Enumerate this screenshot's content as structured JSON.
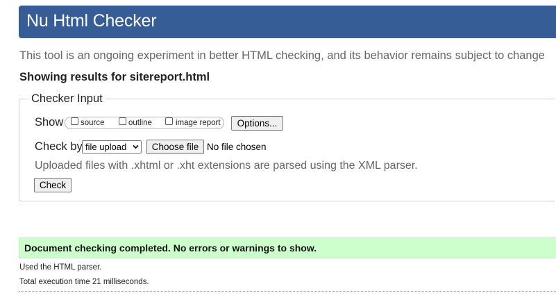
{
  "header": {
    "title": "Nu Html Checker"
  },
  "tagline": "This tool is an ongoing experiment in better HTML checking, and its behavior remains subject to change",
  "results_heading": "Showing results for sitereport.html",
  "checker_input": {
    "legend": "Checker Input",
    "show": {
      "label": "Show",
      "options": [
        {
          "label": "source",
          "checked": false
        },
        {
          "label": "outline",
          "checked": false
        },
        {
          "label": "image report",
          "checked": false
        }
      ],
      "options_button": "Options..."
    },
    "check_by": {
      "label": "Check by",
      "selected": "file upload",
      "choose_file_button": "Choose file",
      "file_status": "No file chosen"
    },
    "hint": "Uploaded files with .xhtml or .xht extensions are parsed using the XML parser.",
    "check_button": "Check"
  },
  "result": {
    "message": "Document checking completed. No errors or warnings to show.",
    "parser_note": "Used the HTML parser.",
    "execution_time": "Total execution time 21 milliseconds."
  },
  "colors": {
    "header_bg": "#365d95",
    "success_bg": "#ccffcc",
    "muted_text": "#666666"
  },
  "icons": [
    "chevron-down-icon"
  ]
}
